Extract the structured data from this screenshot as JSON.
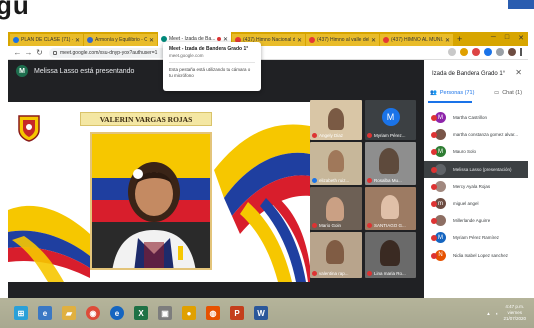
{
  "top_text": "gu",
  "browser": {
    "tabs": [
      {
        "label": "PLAN DE CLASE (71) - relleB...",
        "fav": "#1a73e8"
      },
      {
        "label": "Armonía y Equilibrio - C...",
        "fav": "#3366cc"
      },
      {
        "label": "Meet - Izada de Ba...",
        "fav": "#00897b",
        "active": true
      },
      {
        "label": "(437) Himno Nacional d...",
        "fav": "#e53935"
      },
      {
        "label": "(437) Himno al valle del...",
        "fav": "#e53935"
      },
      {
        "label": "(437) HIMNO AL MUNI...",
        "fav": "#e53935"
      }
    ],
    "new_tab": "+",
    "address": "meet.google.com/xsu-dnyp-yox?authuser=1",
    "window_controls": [
      "─",
      "□",
      "✕"
    ]
  },
  "tooltip": {
    "title": "Meet - Izada de Bandera Grado 1°",
    "url": "meet.google.com",
    "camera_note": "Esta pestaña está utilizando tu cámara o tu micrófono"
  },
  "meet": {
    "presenter_initial": "M",
    "presenter_text": "Melissa Lasso está presentando",
    "slide_name": "VALERIN VARGAS ROJAS",
    "tiles": [
      {
        "name": "Angely Diaz"
      },
      {
        "name": "Myriam Pérez..."
      },
      {
        "name": "elizabeth ruiz..."
      },
      {
        "name": "Rosalba Mu..."
      },
      {
        "name": "Mario Goin"
      },
      {
        "name": "SANTIAGO G..."
      },
      {
        "name": "valentina rap..."
      },
      {
        "name": "Lina maria Ro..."
      }
    ],
    "tile_avatar_initial": "M"
  },
  "panel": {
    "title": "Izada de Bandera Grado 1°",
    "people_tab": "Personas (71)",
    "chat_tab": "Chat (1)",
    "participants": [
      {
        "initial": "M",
        "name": "Martha Castrillon",
        "color": "#8e24aa"
      },
      {
        "initial": "",
        "name": "martha constanza gomez alvar...",
        "color": "#795548"
      },
      {
        "initial": "M",
        "name": "Mauro Solo",
        "color": "#2e7d32"
      },
      {
        "initial": "",
        "name": "Melissa Lasso (presentación)",
        "color": "#5f6368",
        "highlight": true
      },
      {
        "initial": "",
        "name": "Mercy Ayala Rojas",
        "color": "#a1887f"
      },
      {
        "initial": "m",
        "name": "miguel angel",
        "color": "#6d4c41"
      },
      {
        "initial": "",
        "name": "Millerlande Aguirre",
        "color": "#8d6e63"
      },
      {
        "initial": "M",
        "name": "Myriam Pérez Ramírez",
        "color": "#1565c0"
      },
      {
        "initial": "N",
        "name": "Nidia Isabel Lopez sanchez",
        "color": "#e65100"
      }
    ]
  },
  "taskbar": {
    "clock_time": "4:47 p.m.",
    "clock_day": "viernes",
    "clock_date": "21/07/2020"
  }
}
